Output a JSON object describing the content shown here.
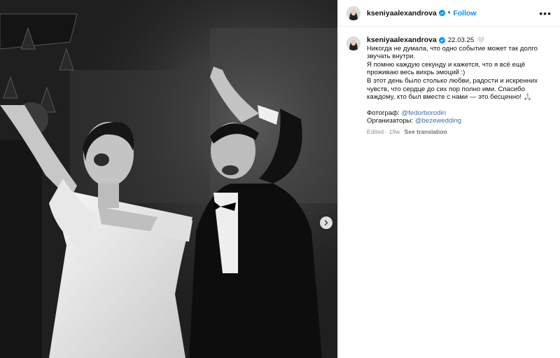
{
  "post": {
    "username": "kseniyaalexandrova",
    "follow_label": "Follow",
    "more_label": "•••",
    "separator": "•"
  },
  "caption": {
    "username": "kseniyaalexandrova",
    "date": "22.03.25",
    "heart": "🤍",
    "lines": [
      "Никогда не думала, что одно событие может так долго",
      "звучать внутри.",
      "Я помню каждую секунду и кажется, что я всё ещё",
      "проживаю весь вихрь эмоций :)",
      "В этот день было столько любви, радости и искренних",
      "чувств, что сердце до сих пор полно ими. Спасибо",
      "каждому, кто был вместе с нами — это бесценно! 🙏🏻"
    ],
    "photographer_label": "Фотограф:",
    "photographer_mention": "@fedorborodin",
    "organizers_label": "Организаторы:",
    "organizers_mention": "@bezewedding",
    "edited": "Edited",
    "age": "19w",
    "see_translation": "See translation"
  },
  "icons": {
    "verified": "verified-badge-icon",
    "next": "chevron-right-icon"
  },
  "colors": {
    "link": "#0095f6",
    "mention": "#3b6cb6",
    "muted": "#8e8e8e"
  }
}
